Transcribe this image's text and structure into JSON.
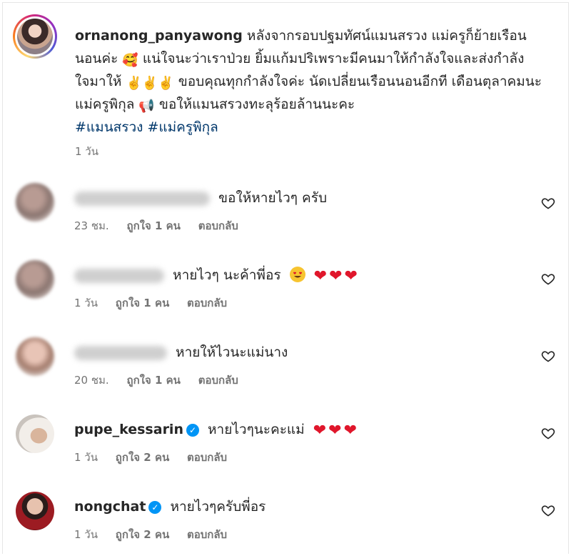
{
  "post": {
    "username": "ornanong_panyawong",
    "caption_1": "หลังจากรอบปฐมทัศน์แมนสรวง แม่ครูก็ย้ายเรือนนอนค่ะ",
    "caption_2": "แน่ใจนะว่าเราป่วย ยิ้มแก้มปริเพราะมีคนมาให้กำลังใจและส่งกำลังใจมาให้",
    "caption_3": "ขอบคุณทุกกำลังใจค่ะ นัดเปลี่ยนเรือนนอนอีกที เดือนตุลาคมนะแม่ครูพิกุล",
    "caption_4": "ขอให้แมนสรวงทะลุร้อยล้านนะคะ",
    "hashtag_1": "#แมนสรวง",
    "hashtag_2": "#แม่ครูพิกุล",
    "time": "1 วัน"
  },
  "comments": [
    {
      "user": "",
      "text": "ขอให้หายไวๆ ครับ",
      "time": "23 ชม.",
      "likes": "ถูกใจ 1 คน",
      "reply": "ตอบกลับ"
    },
    {
      "user": "",
      "text": "หายไวๆ นะค้าพี่อร",
      "time": "1 วัน",
      "likes": "ถูกใจ 1 คน",
      "reply": "ตอบกลับ"
    },
    {
      "user": "",
      "text": "หายให้ไวนะแม่นาง",
      "time": "20 ชม.",
      "likes": "ถูกใจ 1 คน",
      "reply": "ตอบกลับ"
    },
    {
      "user": "pupe_kessarin",
      "text": "หายไวๆนะคะแม่",
      "time": "1 วัน",
      "likes": "ถูกใจ 2 คน",
      "reply": "ตอบกลับ"
    },
    {
      "user": "nongchat",
      "text": "หายไวๆครับพี่อร",
      "time": "1 วัน",
      "likes": "ถูกใจ 2 คน",
      "reply": "ตอบกลับ"
    }
  ],
  "colors": {
    "link": "#00376b",
    "meta": "#737373",
    "verified": "#0095f6",
    "heart": "#e0162b"
  },
  "icons": {
    "like": "heart-outline-icon",
    "verified": "verified-badge-icon"
  }
}
